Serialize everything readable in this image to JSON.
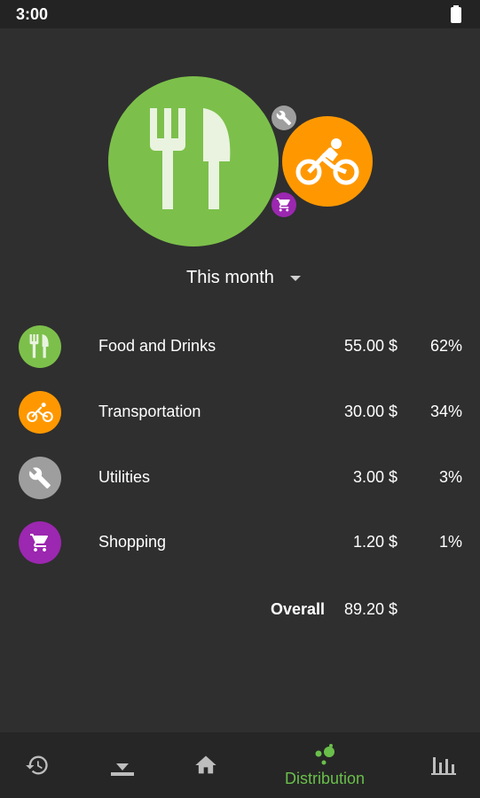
{
  "status_bar": {
    "time": "3:00"
  },
  "bubbles": [
    {
      "category": "Food and Drinks",
      "color": "#7cc04b",
      "icon": "fork-knife-icon"
    },
    {
      "category": "Transportation",
      "color": "#ff9800",
      "icon": "bicycle-icon"
    },
    {
      "category": "Utilities",
      "color": "#9e9e9e",
      "icon": "wrench-icon"
    },
    {
      "category": "Shopping",
      "color": "#9c27b0",
      "icon": "cart-icon"
    }
  ],
  "period": {
    "label": "This month"
  },
  "categories": [
    {
      "name": "Food and Drinks",
      "amount": "55.00 $",
      "percent": "62%",
      "color": "#7cc04b",
      "icon": "fork-knife-icon"
    },
    {
      "name": "Transportation",
      "amount": "30.00 $",
      "percent": "34%",
      "color": "#ff9800",
      "icon": "bicycle-icon"
    },
    {
      "name": "Utilities",
      "amount": "3.00 $",
      "percent": "3%",
      "color": "#9e9e9e",
      "icon": "wrench-icon"
    },
    {
      "name": "Shopping",
      "amount": "1.20 $",
      "percent": "1%",
      "color": "#9c27b0",
      "icon": "cart-icon"
    }
  ],
  "overall": {
    "label": "Overall",
    "amount": "89.20 $"
  },
  "bottom_nav": {
    "items": [
      {
        "icon": "history-icon",
        "label": ""
      },
      {
        "icon": "import-icon",
        "label": ""
      },
      {
        "icon": "home-icon",
        "label": ""
      },
      {
        "icon": "distribution-icon",
        "label": "Distribution",
        "active": true
      },
      {
        "icon": "bar-chart-icon",
        "label": ""
      }
    ],
    "active_color": "#6abf4b"
  }
}
